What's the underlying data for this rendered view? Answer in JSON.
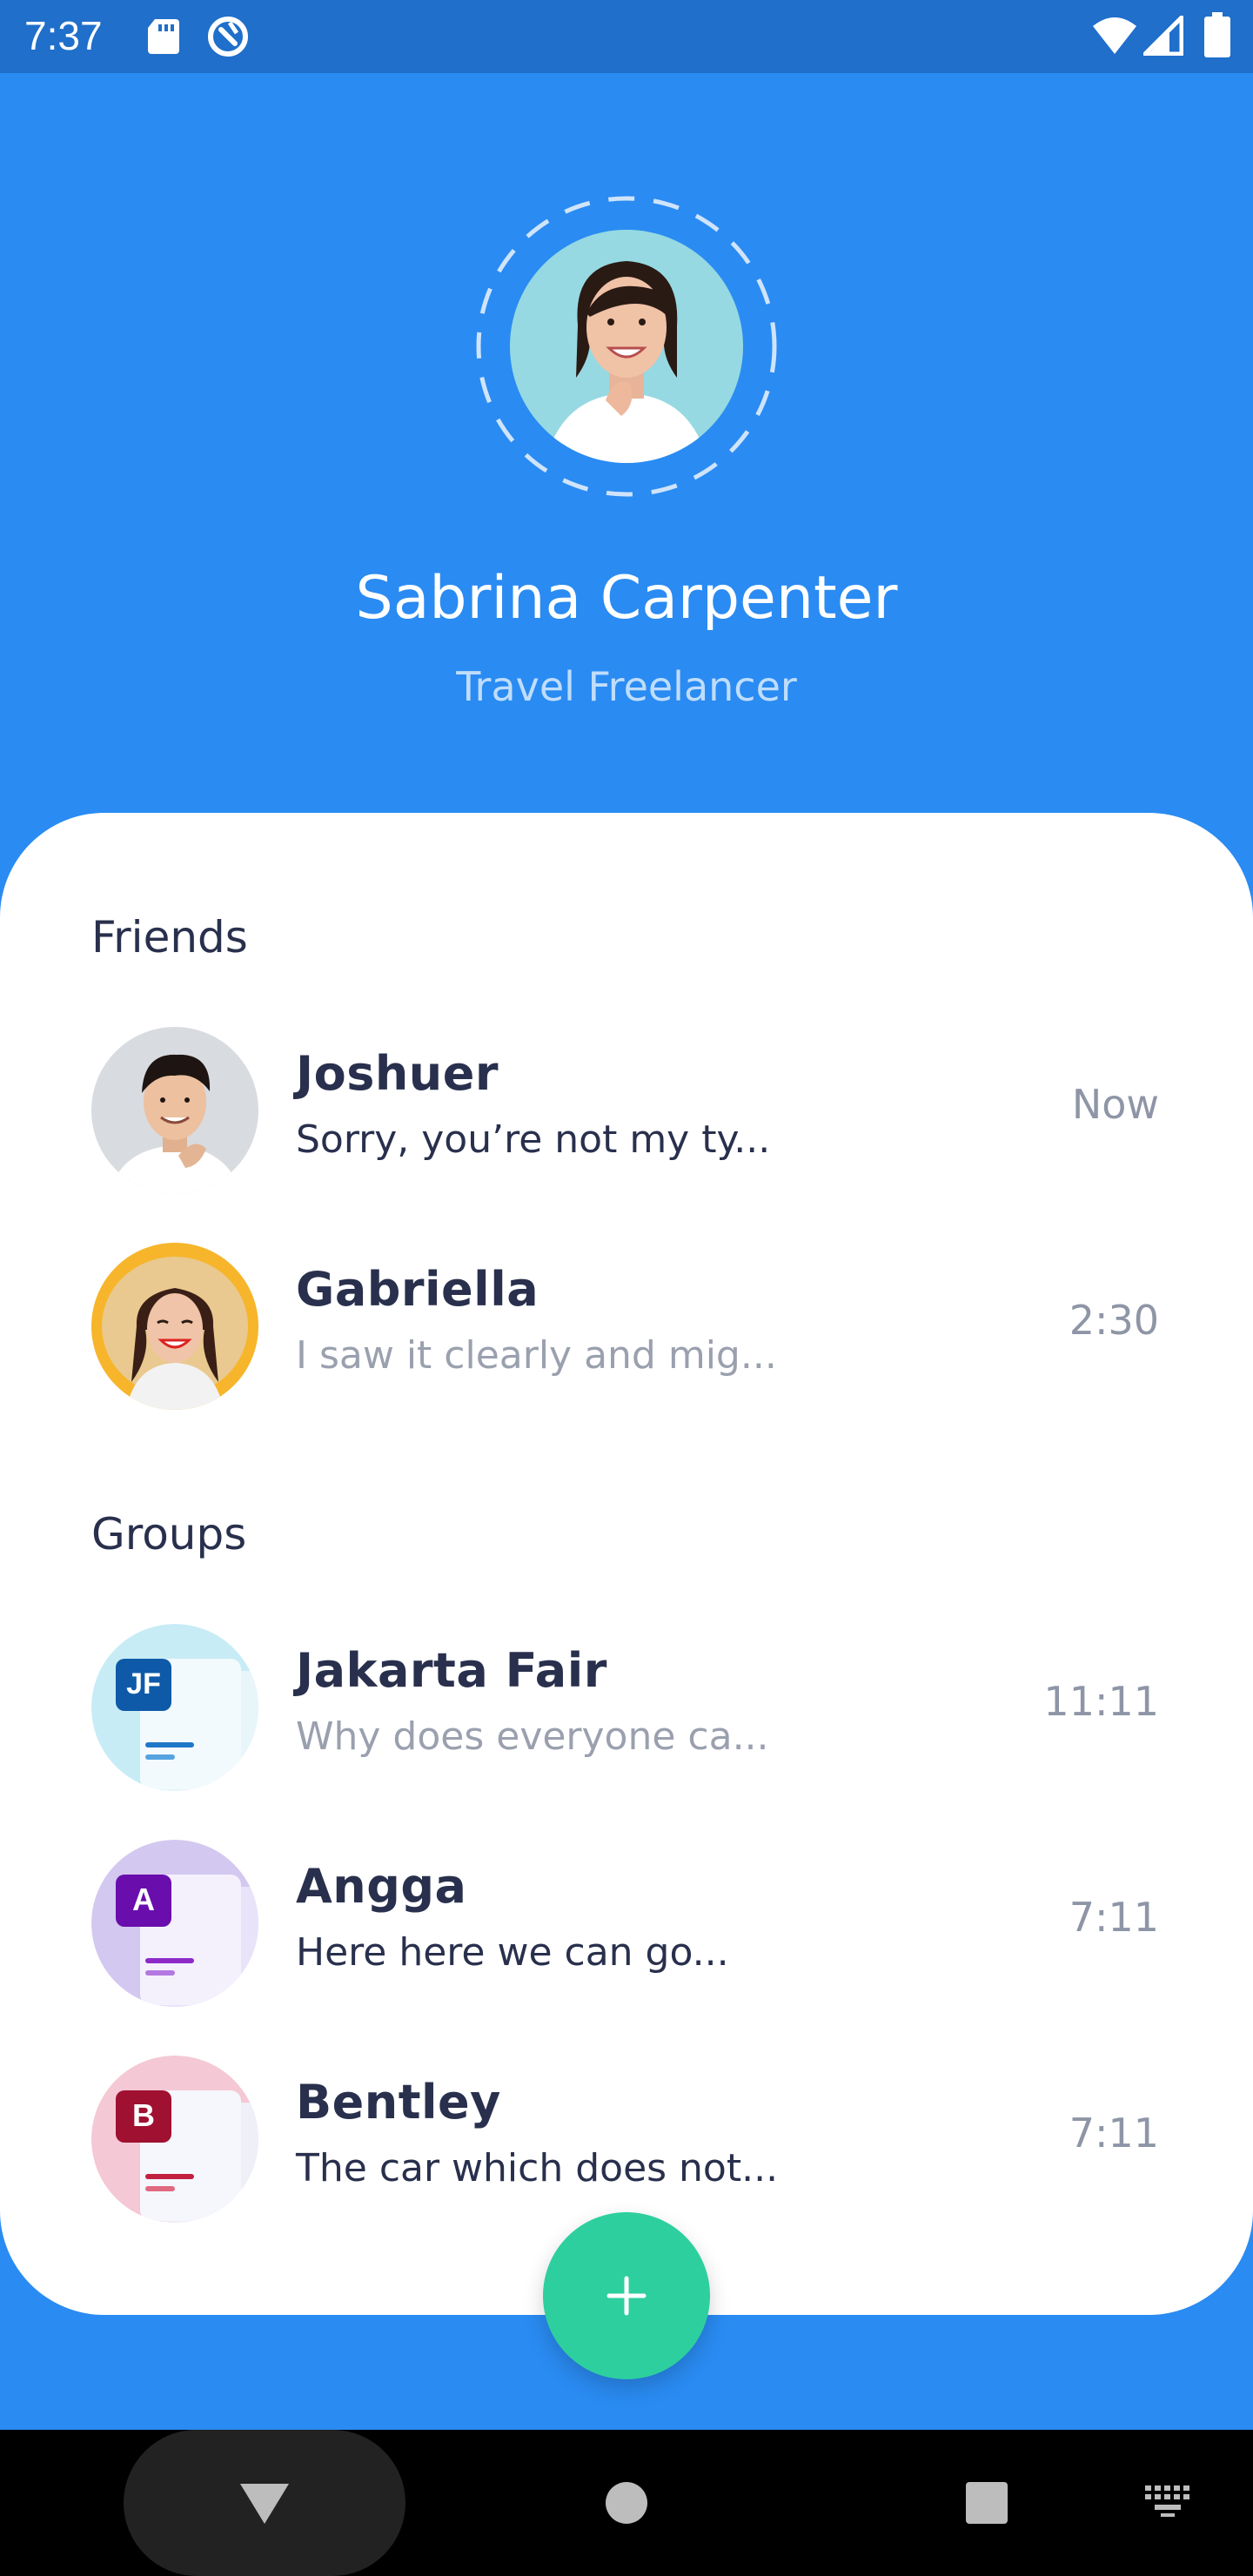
{
  "status_bar": {
    "time": "7:37"
  },
  "profile": {
    "name": "Sabrina Carpenter",
    "role": "Travel Freelancer"
  },
  "friends": {
    "title": "Friends",
    "items": [
      {
        "name": "Joshuer",
        "message": "Sorry, you’re not my ty...",
        "time": "Now"
      },
      {
        "name": "Gabriella",
        "message": "I saw it clearly and mig...",
        "time": "2:30"
      }
    ]
  },
  "groups": {
    "title": "Groups",
    "items": [
      {
        "name": "Jakarta Fair",
        "message": "Why does everyone ca...",
        "time": "11:11",
        "badge": "JF",
        "accent": "#0E5AA8",
        "bg": "#C8ECF6"
      },
      {
        "name": "Angga",
        "message": "Here here we can go...",
        "time": "7:11",
        "badge": "A",
        "accent": "#6A0DAD",
        "bg": "#D3C8F0"
      },
      {
        "name": "Bentley",
        "message": "The car which does not...",
        "time": "7:11",
        "badge": "B",
        "accent": "#A01030",
        "bg": "#F4C8D4"
      }
    ]
  },
  "colors": {
    "primary": "#2A8BF2",
    "fab": "#2ECF9E",
    "text_dark": "#29304D",
    "text_light": "#9AA0AE"
  },
  "fab": {
    "icon": "plus-icon"
  }
}
